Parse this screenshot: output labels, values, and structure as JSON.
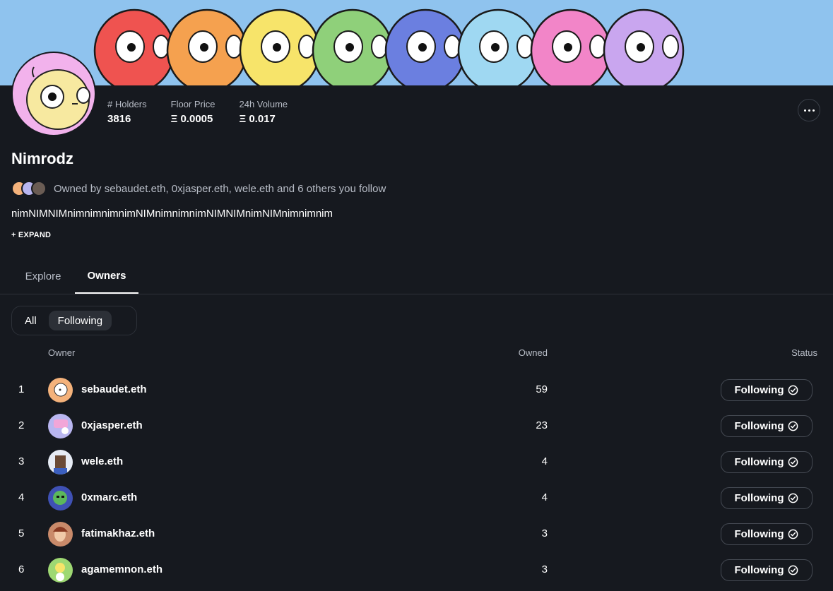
{
  "collection": {
    "title": "Nimrodz",
    "description": "nimNIMNIMnimnimnimnimNIMnimnimnimNIMNIMnimNIMnimnimnim",
    "expand_label": "+ EXPAND",
    "owned_by_text": "Owned by sebaudet.eth, 0xjasper.eth, wele.eth and 6 others you follow",
    "banner_colors": [
      "#ef5350",
      "#f5a14f",
      "#f7e46a",
      "#8fd07a",
      "#6b7fe0",
      "#9fd8f2",
      "#f285c8",
      "#c9a6ef"
    ],
    "avatar_color": "#f7e9a0"
  },
  "stats": [
    {
      "label": "# Holders",
      "value": "3816"
    },
    {
      "label": "Floor Price",
      "value": "Ξ 0.0005"
    },
    {
      "label": "24h Volume",
      "value": "Ξ 0.017"
    }
  ],
  "more_button": {
    "icon": "ellipsis-icon"
  },
  "tabs": [
    {
      "label": "Explore",
      "active": false
    },
    {
      "label": "Owners",
      "active": true
    }
  ],
  "filter": {
    "options": [
      {
        "label": "All",
        "active": false
      },
      {
        "label": "Following",
        "active": true
      }
    ]
  },
  "table": {
    "headers": {
      "owner": "Owner",
      "owned": "Owned",
      "status": "Status"
    },
    "status_icon": "check-circle-icon",
    "rows": [
      {
        "rank": "1",
        "name": "sebaudet.eth",
        "owned": "59",
        "status": "Following",
        "avatar_color": "#f4b27b"
      },
      {
        "rank": "2",
        "name": "0xjasper.eth",
        "owned": "23",
        "status": "Following",
        "avatar_color": "#b9b6f0"
      },
      {
        "rank": "3",
        "name": "wele.eth",
        "owned": "4",
        "status": "Following",
        "avatar_color": "#e7ecf5"
      },
      {
        "rank": "4",
        "name": "0xmarc.eth",
        "owned": "4",
        "status": "Following",
        "avatar_color": "#3f51b5"
      },
      {
        "rank": "5",
        "name": "fatimakhaz.eth",
        "owned": "3",
        "status": "Following",
        "avatar_color": "#c98a6a"
      },
      {
        "rank": "6",
        "name": "agamemnon.eth",
        "owned": "3",
        "status": "Following",
        "avatar_color": "#9ed873"
      }
    ]
  },
  "mini_avatar_colors": [
    "#f4b27b",
    "#b9b6f0",
    "#6a5c54"
  ]
}
